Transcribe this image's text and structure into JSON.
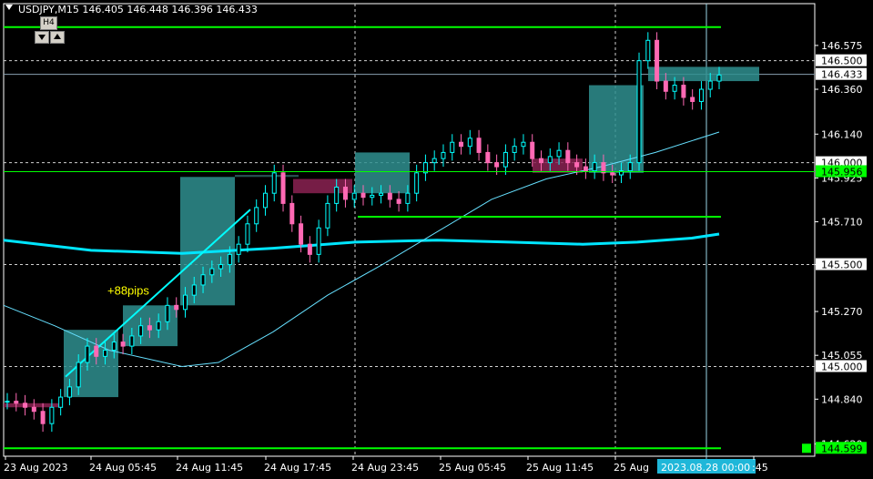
{
  "header": {
    "symbol": "USDJPY,M15",
    "open": "146.405",
    "high": "146.448",
    "low": "146.396",
    "close": "146.433",
    "timeframe_button": "H4"
  },
  "annotation": {
    "text": "+88pips",
    "color": "#ffff00"
  },
  "price_axis": {
    "min": 144.56,
    "max": 146.78,
    "ticks": [
      "146.575",
      "146.360",
      "146.140",
      "145.925",
      "145.710",
      "145.500",
      "145.270",
      "145.055",
      "144.840",
      "144.620"
    ],
    "labels": [
      {
        "text": "146.500",
        "value": 146.5,
        "bg": "#ffffff",
        "fg": "#000000"
      },
      {
        "text": "146.433",
        "value": 146.433,
        "bg": "#ffffff",
        "fg": "#000000"
      },
      {
        "text": "146.000",
        "value": 146.0,
        "bg": "#ffffff",
        "fg": "#000000"
      },
      {
        "text": "145.956",
        "value": 145.956,
        "bg": "#00ff00",
        "fg": "#000000"
      },
      {
        "text": "145.500",
        "value": 145.5,
        "bg": "#ffffff",
        "fg": "#000000"
      },
      {
        "text": "145.000",
        "value": 145.0,
        "bg": "#ffffff",
        "fg": "#000000"
      },
      {
        "text": "144.599",
        "value": 144.599,
        "bg": "#00ff00",
        "fg": "#000000"
      }
    ]
  },
  "time_axis": {
    "labels": [
      "23 Aug 2023",
      "24 Aug 05:45",
      "24 Aug 11:45",
      "24 Aug 17:45",
      "24 Aug 23:45",
      "25 Aug 05:45",
      "25 Aug 11:45",
      "25 Aug",
      "2023.08.28 00:00",
      ":45"
    ]
  },
  "levels": {
    "green": [
      146.665,
      145.956,
      145.735,
      144.599
    ],
    "dashed": [
      146.5,
      146.0,
      145.5,
      145.0
    ],
    "crosshair_price": 146.433
  },
  "colors": {
    "background": "#000000",
    "bull": "#00ffff",
    "bear": "#ff69b4",
    "box": "#2f8f8f",
    "box_bear": "#8b2252",
    "ma_thick": "#00e5ff",
    "ma_thin": "#66e0ff",
    "level_green": "#00ff00",
    "grid": "#d0d0d0"
  },
  "chart_data": {
    "type": "candlestick",
    "series": [
      {
        "name": "price",
        "values": [
          144.83,
          144.82,
          144.8,
          144.78,
          144.72,
          144.8,
          144.85,
          144.9,
          145.02,
          145.1,
          145.05,
          145.08,
          145.12,
          145.1,
          145.15,
          145.2,
          145.18,
          145.22,
          145.3,
          145.28,
          145.35,
          145.4,
          145.45,
          145.48,
          145.5,
          145.55,
          145.6,
          145.7,
          145.78,
          145.85,
          145.95,
          145.8,
          145.7,
          145.6,
          145.55,
          145.68,
          145.8,
          145.88,
          145.82,
          145.85,
          145.83,
          145.84,
          145.85,
          145.82,
          145.8,
          145.85,
          145.95,
          146.0,
          146.02,
          146.05,
          146.1,
          146.08,
          146.12,
          146.05,
          146.0,
          145.98,
          146.05,
          146.08,
          146.1,
          146.02,
          146.0,
          146.03,
          146.06,
          146.0,
          145.98,
          145.96,
          146.0,
          145.95,
          145.94,
          145.96,
          146.0,
          146.5,
          146.6,
          146.4,
          146.35,
          146.38,
          146.32,
          146.3,
          146.36,
          146.4,
          146.43
        ]
      }
    ]
  }
}
